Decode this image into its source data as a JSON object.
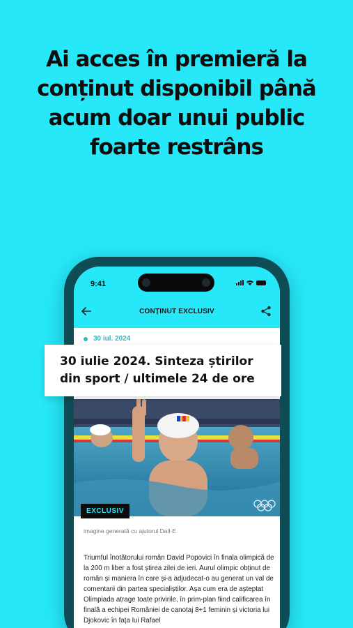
{
  "promo": {
    "headline": "Ai acces în premieră la conținut disponibil până acum doar unui public foarte restrâns"
  },
  "status_bar": {
    "time": "9:41"
  },
  "app_bar": {
    "back_icon": "arrow-left-icon",
    "title": "CONȚINUT EXCLUSIV",
    "share_icon": "share-icon"
  },
  "article": {
    "date": "30 iul. 2024",
    "title": "30 iulie 2024. Sinteza știrilor din sport / ultimele 24 de ore",
    "badge": "EXCLUSIV",
    "image_caption": "imagine generată cu ajutorul Dall-E",
    "body": "Triumful înotătorului român David Popovici în finala olimpică de la 200 m liber a fost știrea zilei de ieri. Aurul olimpic obținut de român și maniera în care și-a adjudecat-o au generat un val de comentarii din partea specialiștilor. Așa cum era de așteptat Olimpiada atrage toate privirile, în prim-plan fiind calificarea în finală a echipei României de canotaj 8+1 feminin și victoria lui Djokovic în fața lui Rafael"
  },
  "colors": {
    "background": "#26e8f9",
    "phone_frame": "#0e4d55",
    "accent_text": "#2bb8c8",
    "badge_bg": "#0d0d0d"
  }
}
